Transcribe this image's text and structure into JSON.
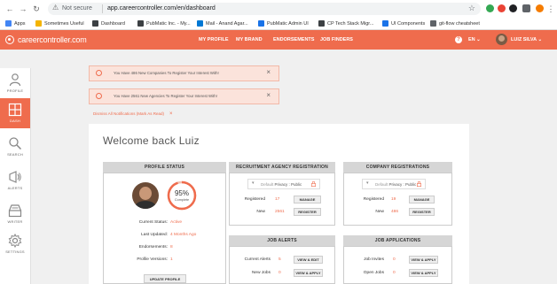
{
  "browser": {
    "secure_label": "Not secure",
    "url": "app.careercontroller.com/en/dashboard",
    "bookmarks": [
      {
        "label": "Apps",
        "color": "#4285f4"
      },
      {
        "label": "Sometimes Useful",
        "color": "#f4b400"
      },
      {
        "label": "Dashboard",
        "color": "#3c4043"
      },
      {
        "label": "PubMatic Inc. - My...",
        "color": "#3c4043"
      },
      {
        "label": "Mail - Anand Agar...",
        "color": "#0078d4"
      },
      {
        "label": "PubMatic Admin UI",
        "color": "#1a73e8"
      },
      {
        "label": "CP Tech Stack Migr...",
        "color": "#3c4043"
      },
      {
        "label": "UI Components",
        "color": "#1a73e8"
      },
      {
        "label": "git-flow cheatsheet",
        "color": "#5f6368"
      }
    ],
    "extension_colors": [
      "#34a853",
      "#ea4335",
      "#202124",
      "#5f6368",
      "#f57c00"
    ]
  },
  "header": {
    "logo_text": "careercontroller.com",
    "nav": [
      "MY PROFILE",
      "MY BRAND",
      "ENDORSEMENTS",
      "JOB FINDERS"
    ],
    "language": "EN",
    "user_name": "LUIZ SILVA",
    "accent": "#ef6c4d"
  },
  "sidebar": {
    "items": [
      {
        "label": "PROFILE",
        "icon": "person-icon"
      },
      {
        "label": "DASH",
        "icon": "dashboard-icon",
        "active": true
      },
      {
        "label": "SEARCH",
        "icon": "search-icon"
      },
      {
        "label": "ALERTS",
        "icon": "alert-broadcast-icon"
      },
      {
        "label": "WRITER",
        "icon": "inbox-icon"
      },
      {
        "label": "SETTINGS",
        "icon": "gear-icon"
      }
    ]
  },
  "notifications": [
    {
      "text": "You Have 486 New Companies To Register Your Interest With!"
    },
    {
      "text": "You Have 2561 New Agencies To Register Your Interest With!"
    }
  ],
  "dismiss_all": "Dismiss All Notifications (Mark As Read)",
  "welcome": "Welcome back Luiz",
  "profile_status": {
    "title": "PROFILE STATUS",
    "percent": "95%",
    "percent_value": 0.95,
    "complete_label": "Complete",
    "rows": [
      {
        "label": "Current Status:",
        "value": "Active"
      },
      {
        "label": "Last Updated:",
        "value": "4 Months Ago"
      },
      {
        "label": "Endorsements:",
        "value": "8"
      },
      {
        "label": "Profile Versions:",
        "value": "1"
      }
    ],
    "update_button": "UPDATE PROFILE"
  },
  "agency_registration": {
    "title": "RECRUITMENT AGENCY REGISTRATION",
    "privacy_prefix": "Default",
    "privacy_value": "Privacy : Public",
    "rows": [
      {
        "label": "Registered",
        "value": "17",
        "button": "MANAGE"
      },
      {
        "label": "New",
        "value": "2561",
        "button": "REGISTER"
      }
    ]
  },
  "company_registrations": {
    "title": "COMPANY REGISTRATIONS",
    "privacy_prefix": "Default",
    "privacy_value": "Privacy : Public",
    "rows": [
      {
        "label": "Registered",
        "value": "19",
        "button": "MANAGE"
      },
      {
        "label": "New",
        "value": "486",
        "button": "REGISTER"
      }
    ]
  },
  "job_alerts": {
    "title": "JOB ALERTS",
    "rows": [
      {
        "label": "Current Alerts",
        "value": "5",
        "button": "VIEW & EDIT"
      },
      {
        "label": "New Jobs",
        "value": "0",
        "button": "VIEW & APPLY"
      }
    ]
  },
  "job_applications": {
    "title": "JOB APPLICATIONS",
    "rows": [
      {
        "label": "Job Invites",
        "value": "0",
        "button": "VIEW & APPLY"
      },
      {
        "label": "Open Jobs",
        "value": "0",
        "button": "VIEW & APPLY"
      }
    ]
  }
}
